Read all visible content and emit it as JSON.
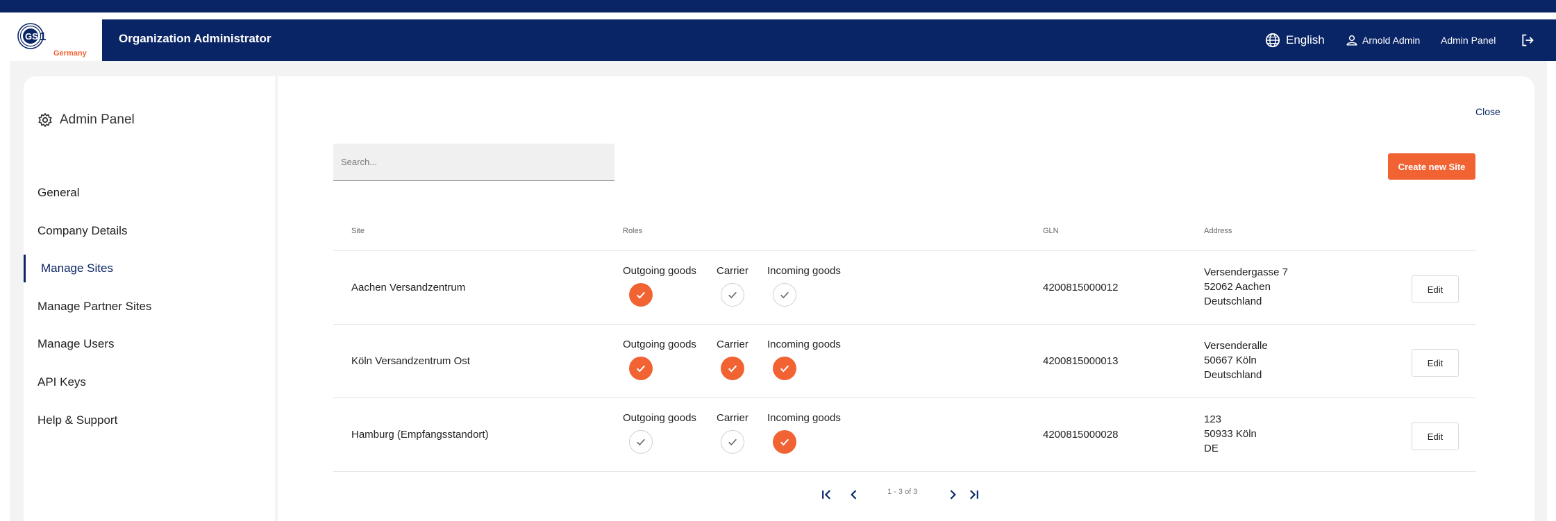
{
  "header": {
    "logo_text": "GS1",
    "logo_subtitle": "Germany",
    "title": "Organization Administrator",
    "language": "English",
    "user_name": "Arnold Admin",
    "admin_panel_link": "Admin Panel",
    "icons": {
      "language": "globe-icon",
      "user": "user-icon",
      "logout": "logout-icon"
    }
  },
  "sidebar": {
    "title": "Admin Panel",
    "title_icon": "gear-icon",
    "items": [
      {
        "label": "General",
        "active": false
      },
      {
        "label": "Company Details",
        "active": false
      },
      {
        "label": "Manage Sites",
        "active": true
      },
      {
        "label": "Manage Partner Sites",
        "active": false
      },
      {
        "label": "Manage Users",
        "active": false
      },
      {
        "label": "API Keys",
        "active": false
      },
      {
        "label": "Help & Support",
        "active": false
      }
    ]
  },
  "main": {
    "close_label": "Close",
    "search_placeholder": "Search...",
    "create_button": "Create new Site",
    "table": {
      "headers": {
        "site": "Site",
        "roles": "Roles",
        "gln": "GLN",
        "address": "Address"
      },
      "role_labels": {
        "outgoing": "Outgoing goods",
        "carrier": "Carrier",
        "incoming": "Incoming goods"
      },
      "edit_label": "Edit",
      "rows": [
        {
          "site": "Aachen Versandzentrum",
          "outgoing": true,
          "carrier": false,
          "incoming": false,
          "gln": "4200815000012",
          "address": [
            "Versendergasse 7",
            "52062 Aachen",
            "Deutschland"
          ]
        },
        {
          "site": "Köln Versandzentrum Ost",
          "outgoing": true,
          "carrier": true,
          "incoming": true,
          "gln": "4200815000013",
          "address": [
            "Versenderalle",
            "50667 Köln",
            "Deutschland"
          ]
        },
        {
          "site": "Hamburg (Empfangsstandort)",
          "outgoing": false,
          "carrier": false,
          "incoming": true,
          "gln": "4200815000028",
          "address": [
            "123",
            "50933 Köln",
            "DE"
          ]
        }
      ]
    },
    "pagination": {
      "info": "1 - 3 of 3"
    }
  },
  "colors": {
    "brand_navy": "#0a2566",
    "accent_orange": "#f26334",
    "panel_bg": "#f3f3f3"
  }
}
